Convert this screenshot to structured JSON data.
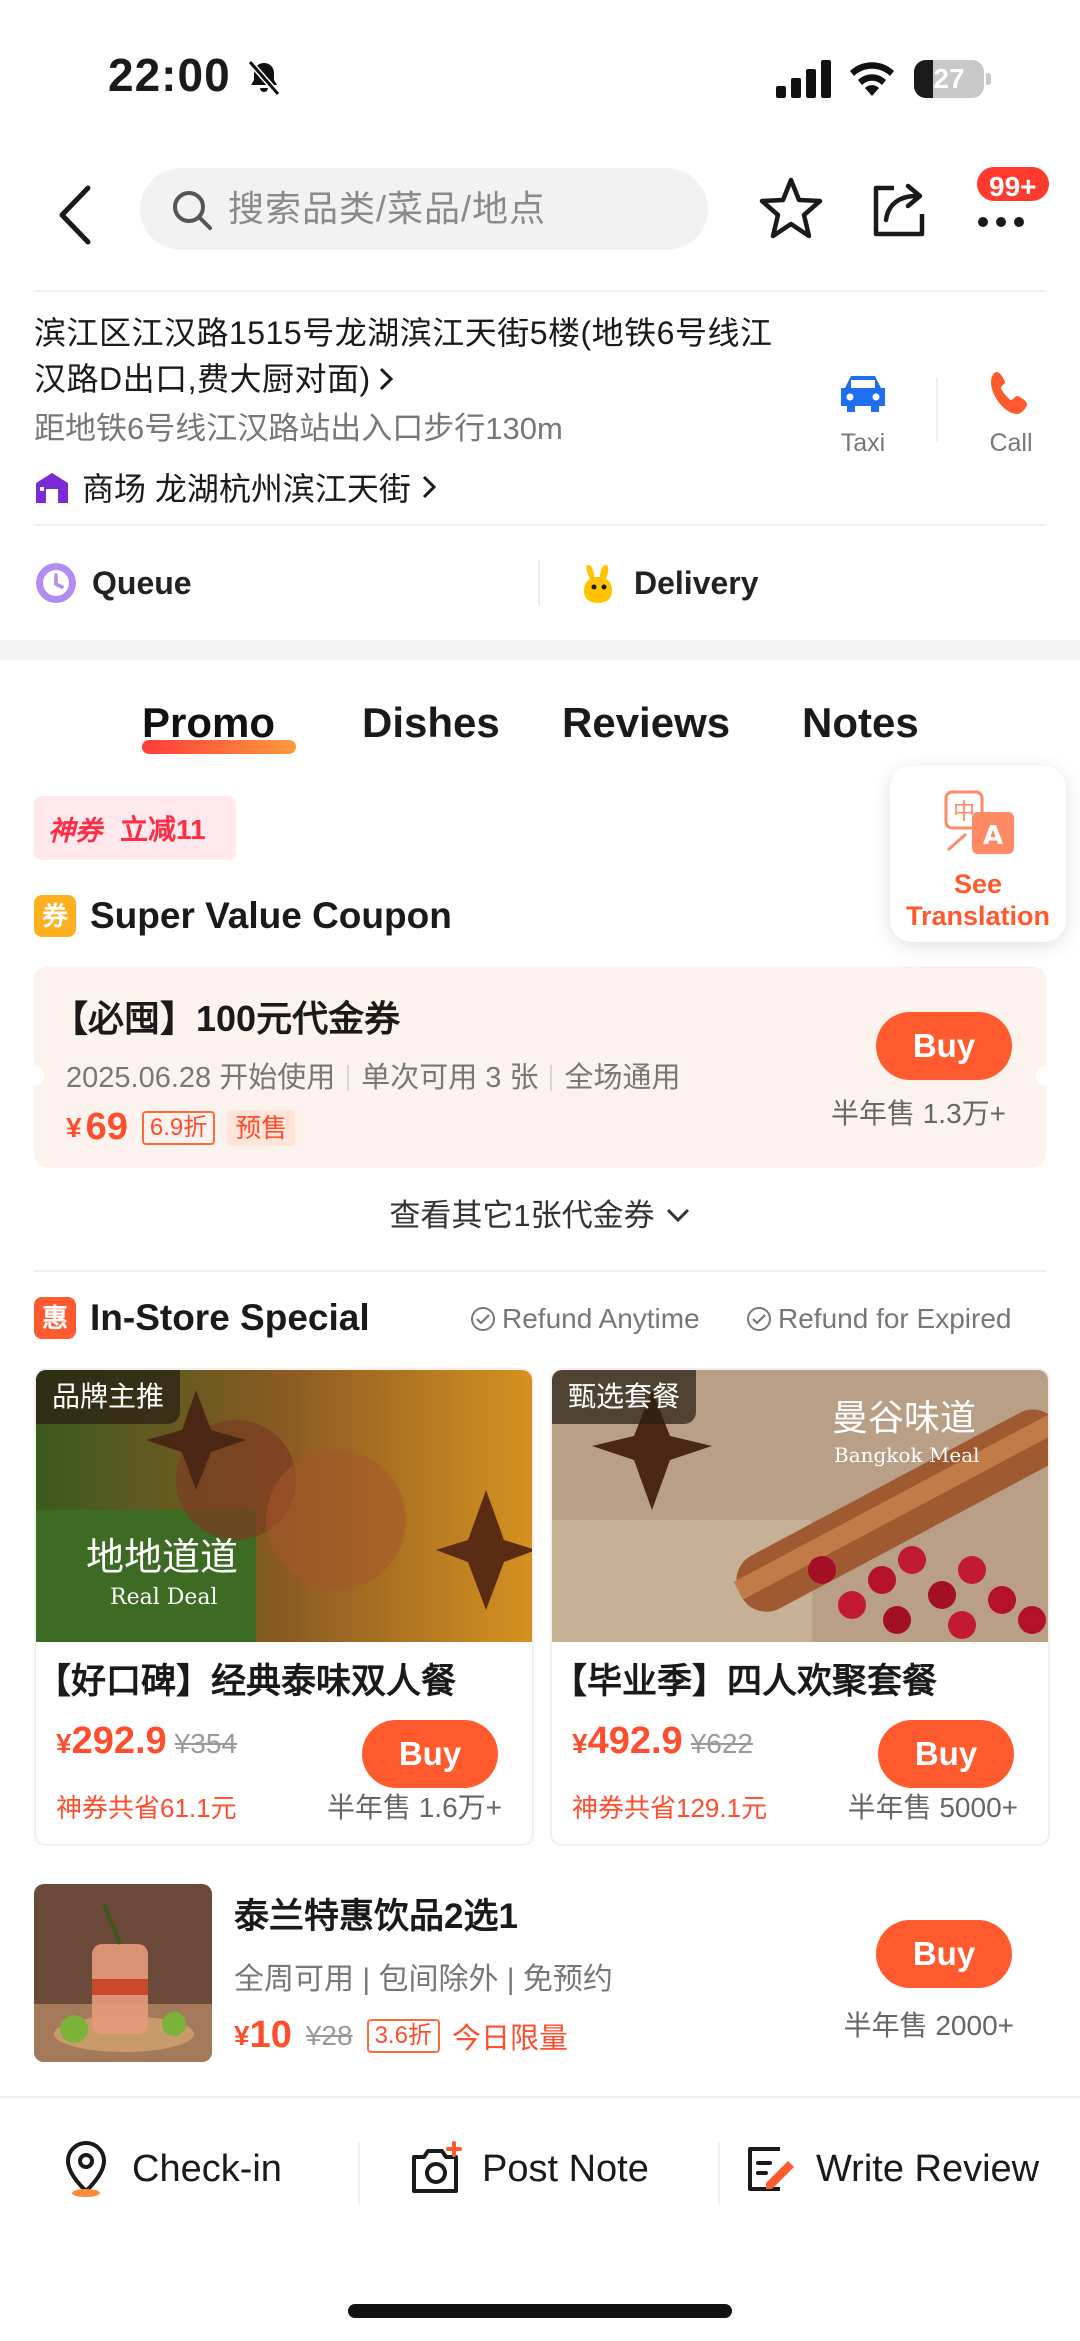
{
  "status_bar": {
    "time": "22:00",
    "battery": "27",
    "battery_level": 0.27
  },
  "header": {
    "search_placeholder": "搜索品类/菜品/地点",
    "more_badge": "99+"
  },
  "address": {
    "line": "滨江区江汉路1515号龙湖滨江天街5楼(地铁6号线江汉路D出口,费大厨对面)",
    "distance": "距地铁6号线江汉路站出入口步行130m",
    "mall_label": "商场 龙湖杭州滨江天街",
    "taxi_label": "Taxi",
    "call_label": "Call"
  },
  "services": {
    "queue": "Queue",
    "delivery": "Delivery"
  },
  "tabs": [
    {
      "label": "Promo"
    },
    {
      "label": "Dishes"
    },
    {
      "label": "Reviews"
    },
    {
      "label": "Notes"
    }
  ],
  "tag": {
    "brand": "神券",
    "offer": "立减11"
  },
  "translate": {
    "label_line1": "See",
    "label_line2": "Translation"
  },
  "coupon_section": {
    "icon": "券",
    "title": "Super Value Coupon",
    "coupon": {
      "title": "【必囤】100元代金券",
      "start": "2025.06.28 开始使用",
      "limit": "单次可用 3 张",
      "scope": "全场通用",
      "price_symbol": "¥",
      "price": "69",
      "discount": "6.9折",
      "presale": "预售",
      "buy": "Buy",
      "sold": "半年售 1.3万+"
    },
    "more": "查看其它1张代金券"
  },
  "special_section": {
    "icon": "惠",
    "title": "In-Store Special",
    "refund_anytime": "Refund Anytime",
    "refund_expired": "Refund for Expired",
    "products": [
      {
        "tag": "品牌主推",
        "name": "【好口碑】经典泰味双人餐",
        "price_symbol": "¥",
        "price": "292.9",
        "original": "¥354",
        "save": "神券共省61.1元",
        "sold": "半年售 1.6万+",
        "buy": "Buy",
        "img_text1": "地地道道",
        "img_text2": "Real Deal"
      },
      {
        "tag": "甄选套餐",
        "name": "【毕业季】四人欢聚套餐",
        "price_symbol": "¥",
        "price": "492.9",
        "original": "¥622",
        "save": "神券共省129.1元",
        "sold": "半年售 5000+",
        "buy": "Buy",
        "img_text1": "曼谷味道",
        "img_text2": "Bangkok Meal"
      }
    ],
    "drink": {
      "name": "泰兰特惠饮品2选1",
      "meta": "全周可用 | 包间除外 | 免预约",
      "price_symbol": "¥",
      "price": "10",
      "original": "¥28",
      "discount": "3.6折",
      "limit": "今日限量",
      "buy": "Buy",
      "sold": "半年售 2000+"
    }
  },
  "bottom_bar": {
    "checkin": "Check-in",
    "post_note": "Post Note",
    "write_review": "Write Review"
  },
  "colors": {
    "accent": "#ff5b2e",
    "price": "#ff4d2d",
    "tag_red": "#ff2d46",
    "badge": "#ff3b2f"
  }
}
